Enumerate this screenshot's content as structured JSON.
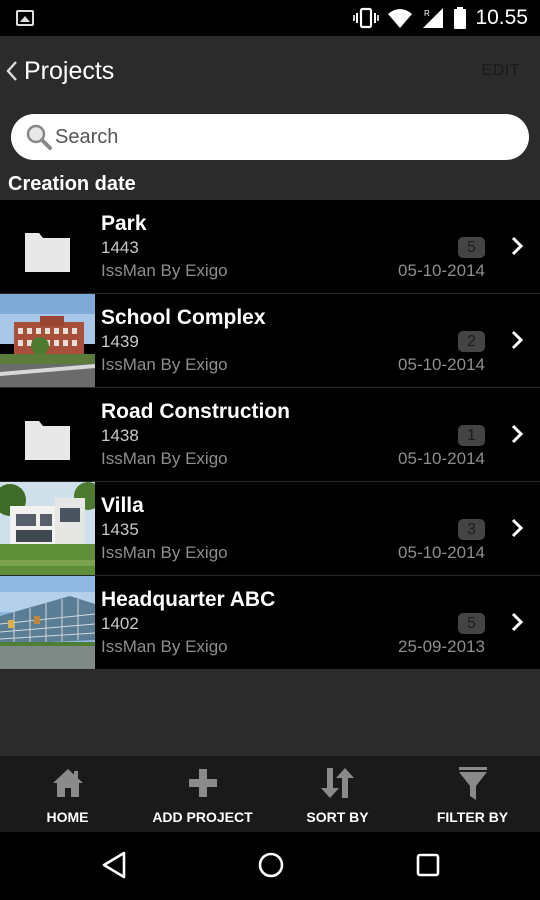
{
  "status_bar": {
    "time": "10.55",
    "icons": [
      "image-notification-icon",
      "vibrate-icon",
      "wifi-icon",
      "signal-icon",
      "battery-icon"
    ]
  },
  "action_bar": {
    "title": "Projects",
    "edit_label": "EDIT"
  },
  "search": {
    "placeholder": "Search"
  },
  "section_header": "Creation date",
  "projects": [
    {
      "name": "Park",
      "number": "1443",
      "owner": "IssMan By Exigo",
      "date": "05-10-2014",
      "count": "5",
      "thumb": "folder"
    },
    {
      "name": "School Complex",
      "number": "1439",
      "owner": "IssMan By Exigo",
      "date": "05-10-2014",
      "count": "2",
      "thumb": "photo"
    },
    {
      "name": "Road Construction",
      "number": "1438",
      "owner": "IssMan By Exigo",
      "date": "05-10-2014",
      "count": "1",
      "thumb": "folder"
    },
    {
      "name": "Villa",
      "number": "1435",
      "owner": "IssMan By Exigo",
      "date": "05-10-2014",
      "count": "3",
      "thumb": "photo"
    },
    {
      "name": "Headquarter ABC",
      "number": "1402",
      "owner": "IssMan By Exigo",
      "date": "25-09-2013",
      "count": "5",
      "thumb": "photo"
    }
  ],
  "toolbar": {
    "home": "HOME",
    "add_project": "ADD PROJECT",
    "sort_by": "SORT BY",
    "filter_by": "FILTER BY"
  },
  "colors": {
    "background": "#000000",
    "bar": "#2b2b2b",
    "toolbar": "#1a1a1a",
    "badge": "#444444"
  }
}
